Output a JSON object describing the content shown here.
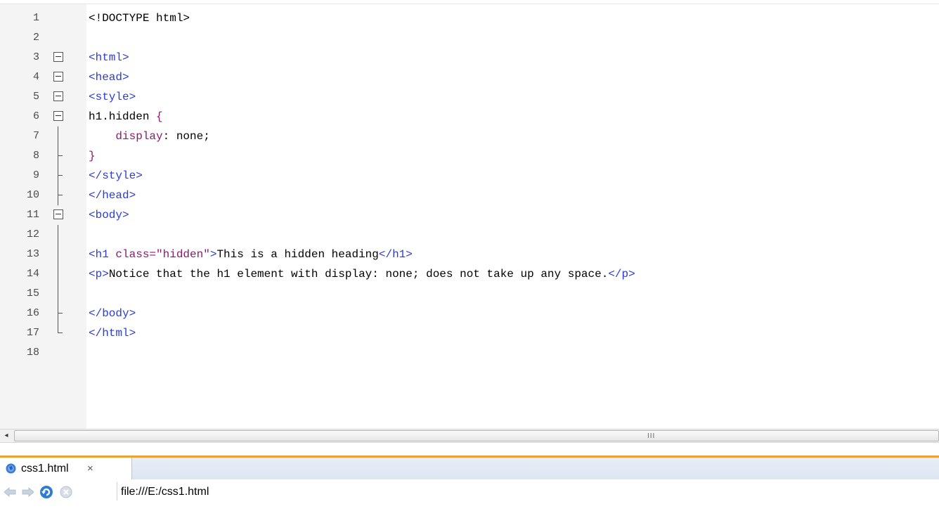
{
  "editor": {
    "lines": [
      {
        "num": "1",
        "fold": "none",
        "segments": [
          {
            "c": "txt",
            "t": "<!DOCTYPE html>"
          }
        ]
      },
      {
        "num": "2",
        "fold": "none",
        "segments": []
      },
      {
        "num": "3",
        "fold": "box",
        "segments": [
          {
            "c": "tag",
            "t": "<html>"
          }
        ]
      },
      {
        "num": "4",
        "fold": "box",
        "segments": [
          {
            "c": "tag",
            "t": "<head>"
          }
        ]
      },
      {
        "num": "5",
        "fold": "box",
        "segments": [
          {
            "c": "tag",
            "t": "<style>"
          }
        ]
      },
      {
        "num": "6",
        "fold": "box",
        "segments": [
          {
            "c": "txt",
            "t": "h1.hidden "
          },
          {
            "c": "brace",
            "t": "{"
          }
        ]
      },
      {
        "num": "7",
        "fold": "vline",
        "segments": [
          {
            "c": "txt",
            "t": "    "
          },
          {
            "c": "prop",
            "t": "display"
          },
          {
            "c": "txt",
            "t": ": none;"
          }
        ]
      },
      {
        "num": "8",
        "fold": "tee",
        "segments": [
          {
            "c": "brace",
            "t": "}"
          }
        ]
      },
      {
        "num": "9",
        "fold": "tee",
        "segments": [
          {
            "c": "tag",
            "t": "</style>"
          }
        ]
      },
      {
        "num": "10",
        "fold": "tee",
        "segments": [
          {
            "c": "tag",
            "t": "</head>"
          }
        ]
      },
      {
        "num": "11",
        "fold": "box",
        "segments": [
          {
            "c": "tag",
            "t": "<body>"
          }
        ]
      },
      {
        "num": "12",
        "fold": "vline",
        "segments": []
      },
      {
        "num": "13",
        "fold": "vline",
        "segments": [
          {
            "c": "tag",
            "t": "<h1 "
          },
          {
            "c": "str",
            "t": "class=\"hidden\""
          },
          {
            "c": "tag",
            "t": ">"
          },
          {
            "c": "txt",
            "t": "This is a hidden heading"
          },
          {
            "c": "tag",
            "t": "</h1>"
          }
        ]
      },
      {
        "num": "14",
        "fold": "vline",
        "segments": [
          {
            "c": "tag",
            "t": "<p>"
          },
          {
            "c": "txt",
            "t": "Notice that the h1 element with display: none; does not take up any space."
          },
          {
            "c": "tag",
            "t": "</p>"
          }
        ]
      },
      {
        "num": "15",
        "fold": "vline",
        "segments": []
      },
      {
        "num": "16",
        "fold": "tee",
        "segments": [
          {
            "c": "tag",
            "t": "</body>"
          }
        ]
      },
      {
        "num": "17",
        "fold": "end",
        "segments": [
          {
            "c": "tag",
            "t": "</html>"
          }
        ]
      },
      {
        "num": "18",
        "fold": "none",
        "segments": []
      }
    ]
  },
  "scrollbar": {
    "left_arrow": "◂",
    "grip": "III"
  },
  "tabs": [
    {
      "label": "css1.html",
      "close": "×",
      "icon": "globe-icon"
    }
  ],
  "navigation": {
    "url": "file:///E:/css1.html",
    "buttons": [
      "back-arrow-icon",
      "forward-arrow-icon",
      "refresh-icon",
      "stop-icon"
    ]
  },
  "colors": {
    "tag": "#2a3cd8",
    "string": "#8b1a6b",
    "text": "#000000",
    "tab_accent": "#f0a030"
  }
}
